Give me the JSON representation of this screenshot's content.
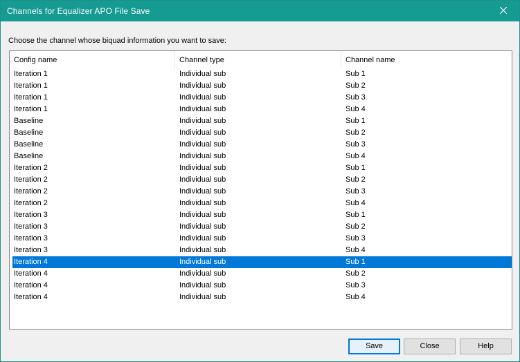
{
  "window": {
    "title": "Channels for Equalizer APO File Save",
    "close_icon": "close-icon",
    "titlebar_color": "#169b92"
  },
  "prompt": "Choose the channel whose biquad information you want to save:",
  "table": {
    "columns": [
      "Config name",
      "Channel type",
      "Channel name"
    ],
    "rows": [
      [
        "Iteration 1",
        "Individual sub",
        "Sub 1"
      ],
      [
        "Iteration 1",
        "Individual sub",
        "Sub 2"
      ],
      [
        "Iteration 1",
        "Individual sub",
        "Sub 3"
      ],
      [
        "Iteration 1",
        "Individual sub",
        "Sub 4"
      ],
      [
        "Baseline",
        "Individual sub",
        "Sub 1"
      ],
      [
        "Baseline",
        "Individual sub",
        "Sub 2"
      ],
      [
        "Baseline",
        "Individual sub",
        "Sub 3"
      ],
      [
        "Baseline",
        "Individual sub",
        "Sub 4"
      ],
      [
        "Iteration 2",
        "Individual sub",
        "Sub 1"
      ],
      [
        "Iteration 2",
        "Individual sub",
        "Sub 2"
      ],
      [
        "Iteration 2",
        "Individual sub",
        "Sub 3"
      ],
      [
        "Iteration 2",
        "Individual sub",
        "Sub 4"
      ],
      [
        "Iteration 3",
        "Individual sub",
        "Sub 1"
      ],
      [
        "Iteration 3",
        "Individual sub",
        "Sub 2"
      ],
      [
        "Iteration 3",
        "Individual sub",
        "Sub 3"
      ],
      [
        "Iteration 3",
        "Individual sub",
        "Sub 4"
      ],
      [
        "Iteration 4",
        "Individual sub",
        "Sub 1"
      ],
      [
        "Iteration 4",
        "Individual sub",
        "Sub 2"
      ],
      [
        "Iteration 4",
        "Individual sub",
        "Sub 3"
      ],
      [
        "Iteration 4",
        "Individual sub",
        "Sub 4"
      ]
    ],
    "selected_row": 16,
    "selection_color": "#0078d7"
  },
  "buttons": {
    "save": "Save",
    "close": "Close",
    "help": "Help"
  }
}
